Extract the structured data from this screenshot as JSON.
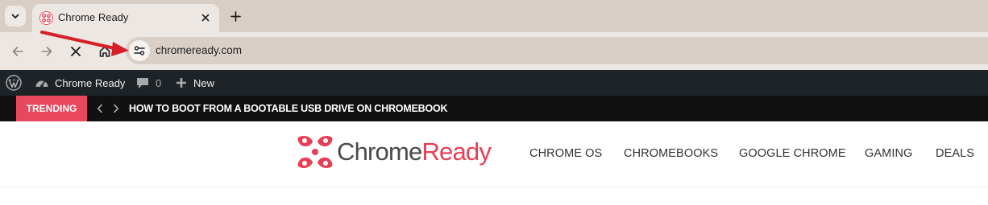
{
  "browser": {
    "tab": {
      "title": "Chrome Ready",
      "favicon": "chromeready-favicon"
    },
    "omnibox": {
      "url": "chromeready.com"
    },
    "icons": {
      "tab_search": "chevron-down-icon",
      "close_tab": "close-icon",
      "new_tab": "plus-icon",
      "back": "arrow-left-icon",
      "forward": "arrow-right-icon",
      "stop": "stop-x-icon",
      "home": "home-icon",
      "site_info": "tune-icon"
    }
  },
  "annotation": {
    "color": "#d61f26"
  },
  "admin_bar": {
    "site_name": "Chrome Ready",
    "comments_count": "0",
    "new_label": "New"
  },
  "trending": {
    "badge": "TRENDING",
    "headline": "HOW TO BOOT FROM A BOOTABLE USB DRIVE ON CHROMEBOOK"
  },
  "site": {
    "logo": {
      "part1": "Chrome",
      "part2": "Ready"
    },
    "nav": [
      "CHROME OS",
      "CHROMEBOOKS",
      "GOOGLE CHROME",
      "GAMING",
      "DEALS"
    ]
  },
  "colors": {
    "accent": "#e8485d",
    "tabstrip": "#d9cec6",
    "toolbar": "#ede7e3",
    "adminbar": "#1d2327",
    "trending_bg": "#111111"
  }
}
